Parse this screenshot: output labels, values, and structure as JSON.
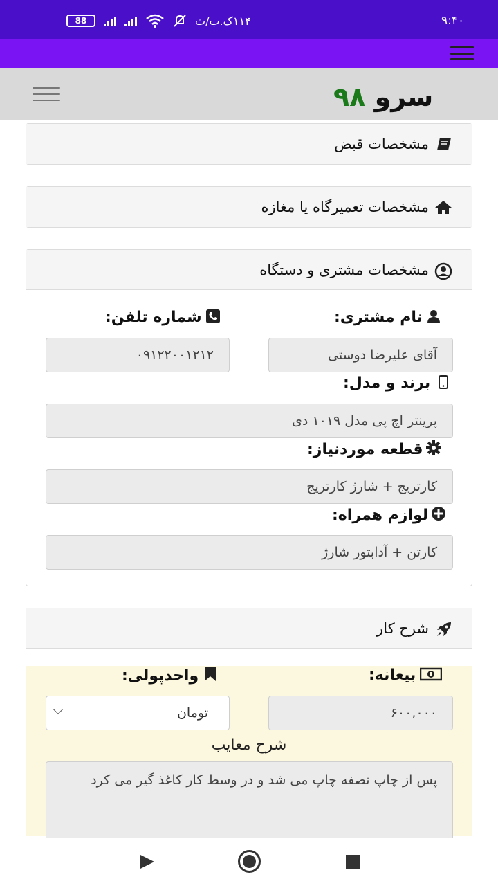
{
  "status": {
    "time": "۹:۴۰",
    "carrier": "۱۱۴ک.ب/ث",
    "battery": "88"
  },
  "header": {
    "logo_word": "سرو",
    "logo_num": "۹۸"
  },
  "panels": {
    "receipt": {
      "title": "مشخصات قبض"
    },
    "shop": {
      "title": "مشخصات تعمیرگاه یا مغازه"
    },
    "customer": {
      "title": "مشخصات مشتری و دستگاه",
      "name_label": "نام مشتری:",
      "name_value": "آقای علیرضا دوستی",
      "phone_label": "شماره تلفن:",
      "phone_value": "۰۹۱۲۲۰۰۱۲۱۲",
      "brand_label": "برند و مدل:",
      "brand_value": "پرینتر اچ پی مدل ۱۰۱۹ دی",
      "part_label": "قطعه موردنیاز:",
      "part_value": "کارتریج + شارژ کارتریج",
      "accessory_label": "لوازم همراه:",
      "accessory_value": "کارتن + آدابتور شارژ"
    },
    "job": {
      "title": "شرح کار",
      "deposit_label": "بیعانه:",
      "deposit_value": "۶۰۰,۰۰۰",
      "currency_label": "واحدپولی:",
      "currency_value": "تومان",
      "defects_label": "شرح معایب",
      "defects_value": "پس از چاپ نصفه چاپ می شد و در وسط کار کاغذ گیر می کرد"
    }
  },
  "icons": {
    "receipt": "book-icon",
    "shop": "home-icon",
    "customer": "user-circle-icon",
    "name": "user-icon",
    "phone": "phone-icon",
    "brand": "mobile-icon",
    "part": "gear-icon",
    "accessory": "plus-circle-icon",
    "job": "rocket-icon",
    "deposit": "money-icon",
    "currency": "bookmark-icon"
  },
  "colors": {
    "status_bar": "#4a0fc9",
    "app_bar": "#7a14f3",
    "logo_number": "#1a7a1a",
    "highlight": "#fcf7df"
  }
}
